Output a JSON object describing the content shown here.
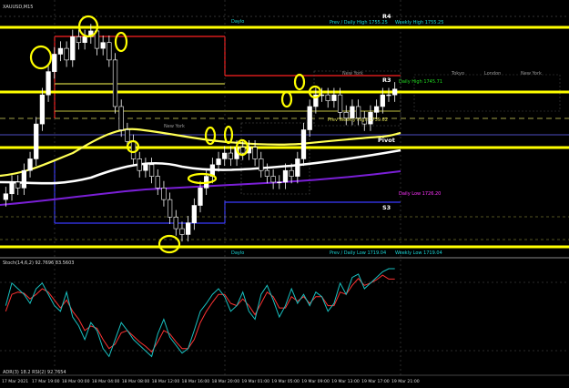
{
  "symbol_label": "XAUUSD,M15",
  "indicator_label": "Stoch(14,6,2) 92.7696 83.5603",
  "bottom_indicator_label": "ADR(3) 18.2 RSI(2) 92.7654",
  "colors": {
    "background": "#000000",
    "candle": "#ffffff",
    "highlight_line": "#ffff00",
    "ma_white": "#ffffff",
    "ma_yellow": "#ffff55",
    "ma_purple": "#7a1fd6",
    "stoch_main": "#19c2c2",
    "stoch_signal": "#ff3333",
    "daily_high_red": "#ff2020",
    "daily_low_blue": "#3b3bff",
    "label_cyan": "#19d6d6",
    "label_green": "#22dd22",
    "label_magenta": "#ff33ff"
  },
  "level_labels": {
    "r4": "R4",
    "r3": "R3",
    "s3": "S3",
    "pivot": "Pivot",
    "prev_daily_high": "Prev / Daily High 1755.25",
    "weekly_high": "Weekly High 1755.25",
    "daily_high": "Daily High 1745.71",
    "prev_weekly_high": "Prev Weekly High 1739.62",
    "daily_low": "Daily Low 1726.20",
    "prev_daily_low": "Prev / Daily Low 1719.04",
    "weekly_low": "Weekly Low 1719.04",
    "session_daily": "Daylo",
    "session_daily2": "Daylo",
    "session_newyork": "New York",
    "session_newyork2": "New York",
    "session_newyork3": "New York",
    "session_tokyo": "Tokyo",
    "session_london": "London"
  },
  "chart_data": {
    "type": "candlestick",
    "symbol": "XAUUSD",
    "timeframe": "M15",
    "x_tick_labels": [
      "17 Mar 2021",
      "17 Mar 19:00",
      "18 Mar 00:00",
      "18 Mar 04:00",
      "18 Mar 08:00",
      "18 Mar 12:00",
      "18 Mar 16:00",
      "18 Mar 20:00",
      "19 Mar 01:00",
      "19 Mar 05:00",
      "19 Mar 09:00",
      "19 Mar 13:00",
      "19 Mar 17:00",
      "19 Mar 21:00"
    ],
    "close_series": [
      1727,
      1729,
      1728,
      1731,
      1733,
      1739,
      1744,
      1748,
      1751,
      1752,
      1750,
      1754,
      1753,
      1754,
      1755,
      1752,
      1753,
      1750,
      1742,
      1738,
      1736,
      1733,
      1731,
      1732,
      1730,
      1728,
      1726,
      1723,
      1721,
      1720,
      1722,
      1725,
      1728,
      1730,
      1732,
      1733,
      1734,
      1733,
      1735,
      1734,
      1735,
      1733,
      1731,
      1730,
      1729,
      1729,
      1731,
      1730,
      1733,
      1738,
      1742,
      1744,
      1744,
      1743,
      1744,
      1741,
      1740,
      1742,
      1740,
      1739,
      1741,
      1742,
      1744,
      1744,
      1745
    ],
    "levels": [
      {
        "name": "R4",
        "value": 1755.25
      },
      {
        "name": "Daily High",
        "value": 1745.71
      },
      {
        "name": "Prev Weekly High",
        "value": 1739.62
      },
      {
        "name": "Daily Low",
        "value": 1726.2
      },
      {
        "name": "Prev / Daily Low",
        "value": 1719.04
      }
    ],
    "indicator": {
      "name": "Stochastic",
      "params": "14,6,2",
      "main": [
        60,
        80,
        75,
        70,
        62,
        75,
        80,
        70,
        60,
        55,
        72,
        50,
        42,
        30,
        45,
        38,
        22,
        15,
        30,
        45,
        38,
        30,
        25,
        20,
        15,
        35,
        48,
        32,
        25,
        18,
        22,
        38,
        55,
        62,
        70,
        75,
        68,
        55,
        60,
        72,
        55,
        48,
        70,
        78,
        65,
        50,
        60,
        75,
        62,
        70,
        60,
        72,
        68,
        55,
        62,
        80,
        70,
        85,
        88,
        75,
        80,
        85,
        90,
        92.77,
        92.77
      ],
      "signal": [
        55,
        70,
        72,
        71,
        66,
        70,
        75,
        72,
        65,
        58,
        65,
        55,
        48,
        38,
        42,
        40,
        30,
        22,
        26,
        36,
        38,
        33,
        28,
        24,
        19,
        28,
        38,
        35,
        28,
        22,
        22,
        30,
        45,
        55,
        63,
        70,
        70,
        62,
        60,
        66,
        60,
        52,
        62,
        72,
        68,
        58,
        58,
        68,
        64,
        68,
        62,
        68,
        68,
        60,
        60,
        72,
        70,
        78,
        84,
        78,
        80,
        83,
        87,
        83.56,
        83.56
      ],
      "ylim": [
        0,
        100
      ]
    }
  }
}
